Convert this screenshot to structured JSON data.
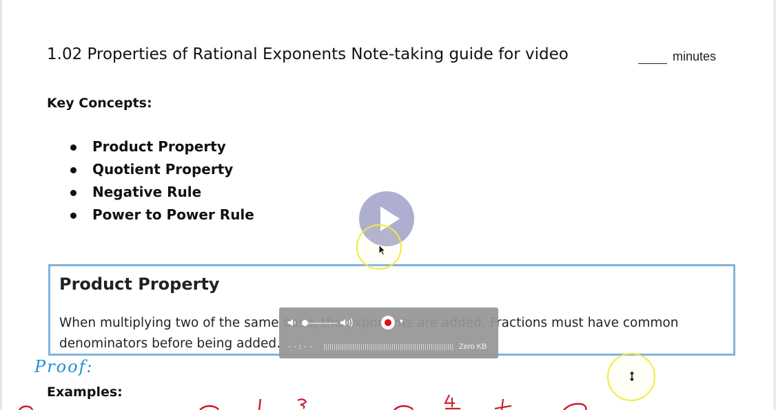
{
  "document": {
    "title": "1.02 Properties of Rational Exponents Note-taking guide for video",
    "minutes_blank": "____",
    "minutes_label": "minutes",
    "key_concepts_heading": "Key Concepts:",
    "concepts": [
      {
        "label": "Product Property"
      },
      {
        "label": "Quotient Property"
      },
      {
        "label": "Negative Rule"
      },
      {
        "label": "Power to Power Rule"
      }
    ],
    "product_box": {
      "heading": "Product Property",
      "text": "When multiplying two of the same base, the exponents are added. Fractions must have common denominators before being added."
    },
    "proof_label": "Proof:",
    "examples_heading": "Examples:"
  },
  "recorder": {
    "time": "--:--",
    "size": "Zero KB",
    "record_color": "#e0101a"
  },
  "colors": {
    "box_border": "#7fb3dc",
    "highlight_circle": "#f0ec3a",
    "proof_ink": "#1f8fd6",
    "annotation_ink": "#cc1e2e",
    "play_button": "#a0a0c8"
  },
  "icons": {
    "play": "play-icon",
    "cursor": "arrow-cursor-icon",
    "resize": "vertical-resize-cursor-icon",
    "volume_low": "volume-low-icon",
    "volume_high": "volume-high-icon",
    "record": "record-icon",
    "chevron": "chevron-down-icon"
  }
}
